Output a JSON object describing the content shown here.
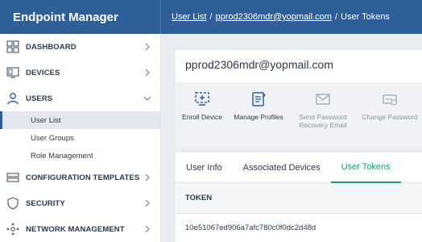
{
  "app": {
    "title": "Endpoint Manager"
  },
  "breadcrumb": {
    "items": [
      "User List",
      "pprod2306mdr@yopmail.com",
      "User Tokens"
    ]
  },
  "sidebar": {
    "items": [
      {
        "label": "DASHBOARD",
        "icon": "dashboard-icon"
      },
      {
        "label": "DEVICES",
        "icon": "devices-icon"
      },
      {
        "label": "USERS",
        "icon": "user-icon",
        "expanded": true,
        "children": [
          {
            "label": "User List",
            "active": true
          },
          {
            "label": "User Groups"
          },
          {
            "label": "Role Management"
          }
        ]
      },
      {
        "label": "CONFIGURATION TEMPLATES",
        "icon": "configuration-icon"
      },
      {
        "label": "SECURITY",
        "icon": "shield-icon"
      },
      {
        "label": "NETWORK MANAGEMENT",
        "icon": "network-icon"
      }
    ]
  },
  "user": {
    "email": "pprod2306mdr@yopmail.com"
  },
  "actions": [
    {
      "label": "Enroll Device",
      "icon": "enroll-device-icon",
      "enabled": true
    },
    {
      "label": "Manage Profiles",
      "icon": "manage-profiles-icon",
      "enabled": true
    },
    {
      "label": "Send Password Recovery Email",
      "icon": "envelope-icon",
      "enabled": false
    },
    {
      "label": "Change Password",
      "icon": "change-password-icon",
      "enabled": false
    }
  ],
  "tabs": [
    {
      "label": "User Info",
      "active": false
    },
    {
      "label": "Associated Devices",
      "active": false
    },
    {
      "label": "User Tokens",
      "active": true
    }
  ],
  "tokens_table": {
    "header": "TOKEN",
    "rows": [
      "10e51067ed906a7afc780c0f0dc2d48d"
    ]
  },
  "colors": {
    "brand": "#2f5f99",
    "accent": "#1e9b7a",
    "text": "#2b3a4a",
    "disabled": "#8a939d"
  }
}
